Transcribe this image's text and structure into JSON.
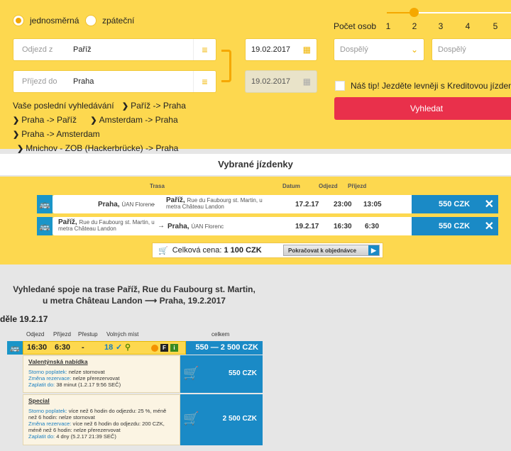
{
  "search": {
    "one_way": "jednosměrná",
    "return": "zpáteční",
    "from_label": "Odjezd z",
    "from_value": "Paříž",
    "to_label": "Příjezd do",
    "to_value": "Praha",
    "date_there": "19.02.2017",
    "date_back": "19.02.2017",
    "recent_label": "Vaše poslední vyhledávání",
    "recent": [
      "Paříž -> Praha",
      "Praha -> Paříž",
      "Amsterdam -> Praha",
      "Praha -> Amsterdam",
      "Mnichov - ZOB (Hackerbrücke) -> Praha"
    ],
    "persons_label": "Počet osob",
    "persons": [
      "1",
      "2",
      "3",
      "4",
      "5"
    ],
    "passenger_1": "Dospělý",
    "passenger_2": "Dospělý",
    "tip": "Náš tip! Jezděte levněji s Kreditovou jízdenkou",
    "search_button": "Vyhledat"
  },
  "selected": {
    "title": "Vybrané jízdenky",
    "headers": {
      "route": "Trasa",
      "date": "Datum",
      "depart": "Odjezd",
      "arrive": "Příjezd"
    },
    "rows": [
      {
        "from": "Praha,",
        "from_sub": "ÚAN Florenc",
        "to": "Paříž,",
        "to_sub": "Rue du Faubourg st. Martin, u metra Château Landon",
        "date": "17.2.17",
        "dep": "23:00",
        "arr": "13:05",
        "price": "550 CZK"
      },
      {
        "from": "Paříž,",
        "from_sub": "Rue du Faubourg st. Martin, u metra Château Landon",
        "to": "Praha,",
        "to_sub": "ÚAN Florenc",
        "date": "19.2.17",
        "dep": "16:30",
        "arr": "6:30",
        "price": "550 CZK"
      }
    ],
    "total_label": "Celková cena:",
    "total_value": "1 100 CZK",
    "continue": "Pokračovat k objednávce"
  },
  "results": {
    "title": "Vyhledané spoje na trase Paříž, Rue du Faubourg st. Martin, u metra Château Landon ⟶ Praha, 19.2.2017",
    "day": "děle 19.2.17",
    "headers": {
      "dep": "Odjezd",
      "arr": "Příjezd",
      "transfer": "Přestup",
      "seats": "Volných míst",
      "total": "celkem"
    },
    "conn": {
      "dep": "16:30",
      "arr": "6:30",
      "transfer": "-",
      "seats": "18",
      "range": "550 — 2 500 CZK"
    },
    "offers": [
      {
        "name": "Valentýnská nabídka",
        "lines": [
          [
            "Storno poplatek:",
            " nelze stornovat"
          ],
          [
            "Změna rezervace:",
            " nelze přerezervovat"
          ],
          [
            "Zaplatit do:",
            " 38 minut (1.2.17 9:56 SEČ)"
          ]
        ],
        "price": "550 CZK"
      },
      {
        "name": "Special",
        "lines": [
          [
            "Storno poplatek:",
            " více než 6 hodin do odjezdu: 25 %, méně než 6 hodin: nelze stornovat"
          ],
          [
            "Změna rezervace:",
            " více než 6 hodin do odjezdu: 200 CZK, méně než 6 hodin: nelze přerezervovat"
          ],
          [
            "Zaplatit do:",
            " 4 dny (5.2.17 21:39 SEČ)"
          ]
        ],
        "price": "2 500 CZK"
      }
    ]
  }
}
